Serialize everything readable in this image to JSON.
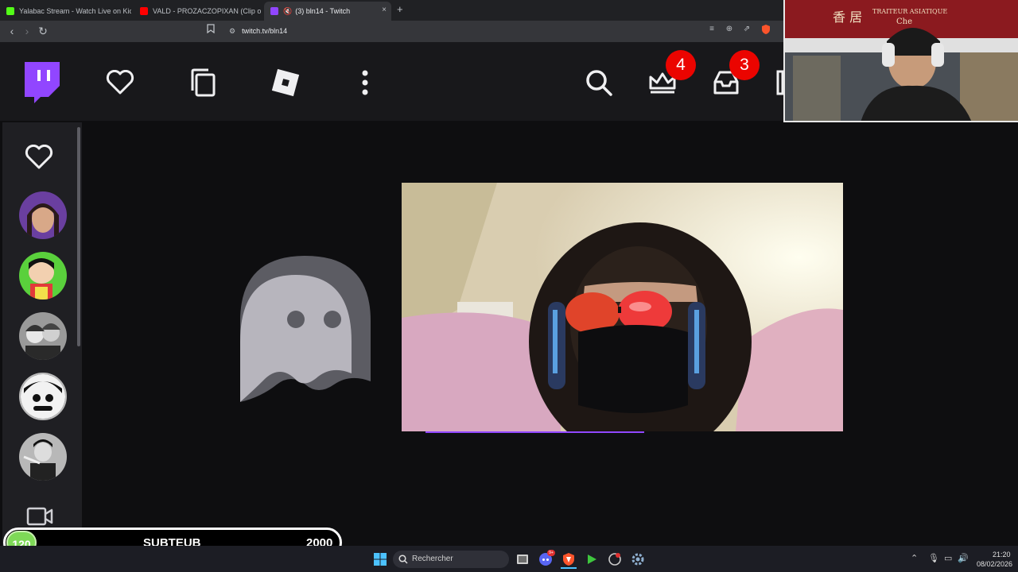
{
  "browser": {
    "tabs": [
      {
        "title": "Yalabac Stream - Watch Live on Kick",
        "favicon_color": "#53fc18"
      },
      {
        "title": "VALD - PROZACZOPIXAN (Clip officiel",
        "favicon_color": "#ff0000"
      },
      {
        "title": "(3) bln14 - Twitch",
        "favicon_color": "#9146ff"
      }
    ],
    "new_tab": "+",
    "close_tab": "×",
    "url": "twitch.tv/bln14"
  },
  "twitch": {
    "accent": "#9146ff",
    "notifications_badge": "4",
    "inbox_badge": "3",
    "badge_color": "#eb0400"
  },
  "webcam_sign": {
    "chinese": "香 居",
    "line1": "TRAITEUR ASIATIQUE",
    "line2": "Che"
  },
  "sidebar": {
    "channels": [
      "channel-1",
      "channel-2",
      "channel-3",
      "channel-4",
      "channel-5"
    ]
  },
  "sub_goal": {
    "current": "120",
    "label": "SUBTEUB",
    "target": "2000",
    "progress": 0.06,
    "bar_color": "#7ed957"
  },
  "taskbar": {
    "search_placeholder": "Rechercher",
    "discord_badge": "9+",
    "time": "21:20",
    "date": "08/02/2026"
  }
}
